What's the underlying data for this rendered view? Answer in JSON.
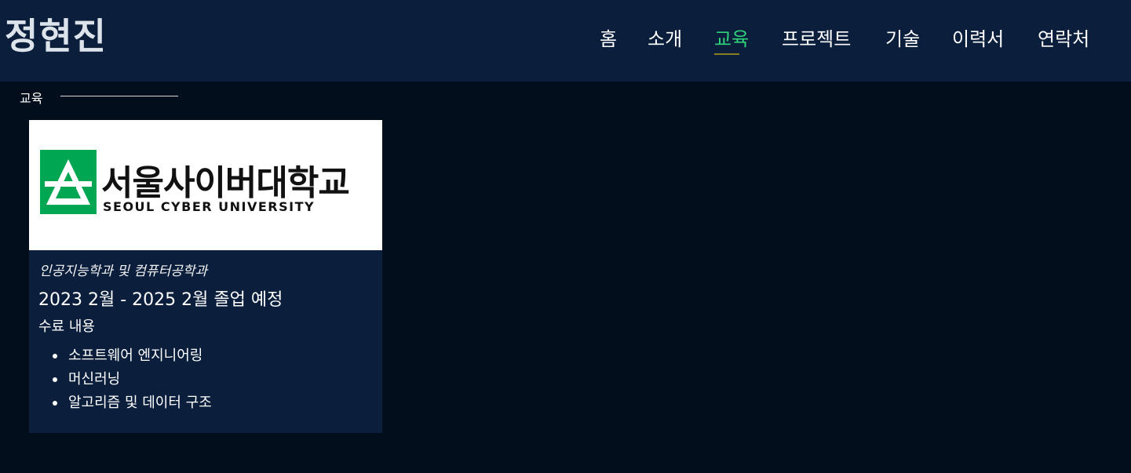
{
  "header": {
    "title": "정현진",
    "nav": [
      {
        "label": "홈",
        "active": false
      },
      {
        "label": "소개",
        "active": false
      },
      {
        "label": "교육",
        "active": true
      },
      {
        "label": "프로젝트",
        "active": false
      },
      {
        "label": "기술",
        "active": false
      },
      {
        "label": "이력서",
        "active": false
      },
      {
        "label": "연락처",
        "active": false
      }
    ]
  },
  "section": {
    "label": "교육"
  },
  "education": {
    "logo_ko": "서울사이버대학교",
    "logo_en": "SEOUL CYBER UNIVERSITY",
    "department": "인공지능학과 및 컴퓨터공학과",
    "period": "2023 2월 - 2025 2월 졸업 예정",
    "courses_title": "수료 내용",
    "courses": [
      "소프트웨어 엔지니어링",
      "머신러닝",
      "알고리즘 및 데이터 구조"
    ]
  },
  "colors": {
    "header_bg": "#0b1f3d",
    "page_bg": "#020e1c",
    "active_nav": "#2fd27a",
    "logo_green": "#00a651"
  }
}
